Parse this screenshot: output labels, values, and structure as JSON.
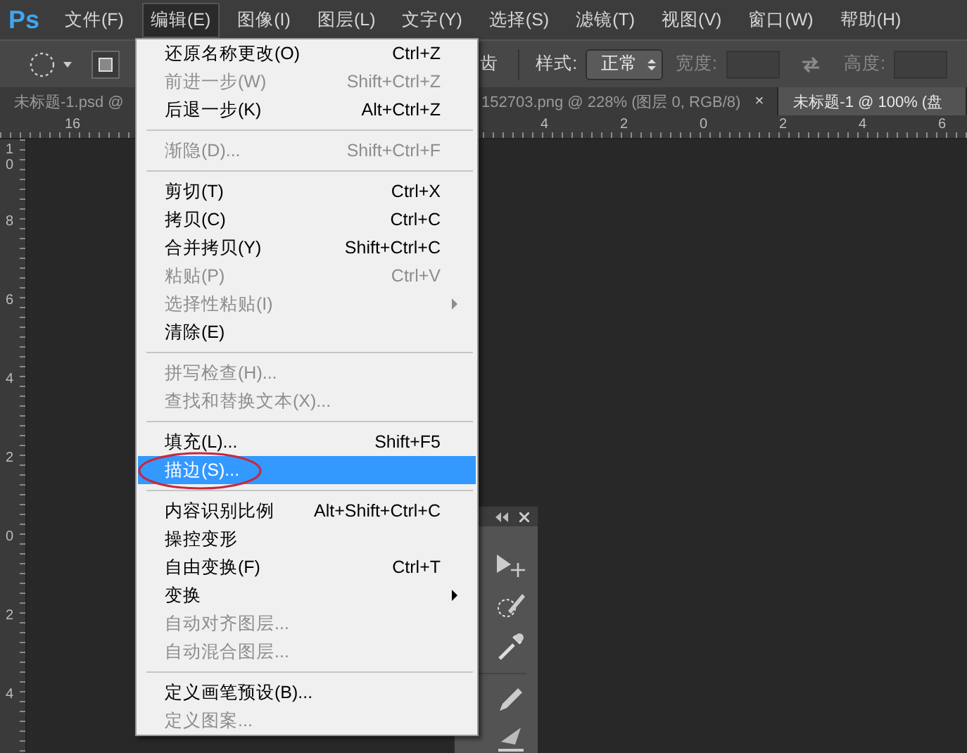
{
  "logo": "Ps",
  "menubar": [
    {
      "label": "文件(F)",
      "selected": false
    },
    {
      "label": "编辑(E)",
      "selected": true
    },
    {
      "label": "图像(I)",
      "selected": false
    },
    {
      "label": "图层(L)",
      "selected": false
    },
    {
      "label": "文字(Y)",
      "selected": false
    },
    {
      "label": "选择(S)",
      "selected": false
    },
    {
      "label": "滤镜(T)",
      "selected": false
    },
    {
      "label": "视图(V)",
      "selected": false
    },
    {
      "label": "窗口(W)",
      "selected": false
    },
    {
      "label": "帮助(H)",
      "selected": false
    }
  ],
  "options_bar": {
    "partial_label": "齿",
    "style": {
      "label": "样式:",
      "value": "正常"
    },
    "width": {
      "label": "宽度:",
      "disabled": true
    },
    "height": {
      "label": "高度:",
      "disabled": true
    }
  },
  "tabs": [
    {
      "title": "未标题-1.psd @",
      "selected": false
    },
    {
      "title": "152703.png @ 228% (图层 0, RGB/8)",
      "selected": false,
      "close": "×"
    },
    {
      "title": "未标题-1 @ 100% (盘",
      "selected": true
    }
  ],
  "rulers": {
    "horizontal": [
      "16",
      "4",
      "2",
      "0",
      "2",
      "4",
      "6"
    ],
    "vertical": [
      "10",
      "8",
      "6",
      "4",
      "2",
      "0",
      "2",
      "4"
    ]
  },
  "edit_menu": [
    {
      "kind": "item",
      "label": "还原名称更改(O)",
      "shortcut": "Ctrl+Z",
      "disabled": false,
      "selected": false,
      "submenu": false,
      "circled": false
    },
    {
      "kind": "item",
      "label": "前进一步(W)",
      "shortcut": "Shift+Ctrl+Z",
      "disabled": true,
      "selected": false,
      "submenu": false,
      "circled": false
    },
    {
      "kind": "item",
      "label": "后退一步(K)",
      "shortcut": "Alt+Ctrl+Z",
      "disabled": false,
      "selected": false,
      "submenu": false,
      "circled": false
    },
    {
      "kind": "separator"
    },
    {
      "kind": "item",
      "label": "渐隐(D)...",
      "shortcut": "Shift+Ctrl+F",
      "disabled": true,
      "selected": false,
      "submenu": false,
      "circled": false
    },
    {
      "kind": "separator"
    },
    {
      "kind": "item",
      "label": "剪切(T)",
      "shortcut": "Ctrl+X",
      "disabled": false,
      "selected": false,
      "submenu": false,
      "circled": false
    },
    {
      "kind": "item",
      "label": "拷贝(C)",
      "shortcut": "Ctrl+C",
      "disabled": false,
      "selected": false,
      "submenu": false,
      "circled": false
    },
    {
      "kind": "item",
      "label": "合并拷贝(Y)",
      "shortcut": "Shift+Ctrl+C",
      "disabled": false,
      "selected": false,
      "submenu": false,
      "circled": false
    },
    {
      "kind": "item",
      "label": "粘贴(P)",
      "shortcut": "Ctrl+V",
      "disabled": true,
      "selected": false,
      "submenu": false,
      "circled": false
    },
    {
      "kind": "item",
      "label": "选择性粘贴(I)",
      "disabled": true,
      "selected": false,
      "submenu": true,
      "circled": false
    },
    {
      "kind": "item",
      "label": "清除(E)",
      "disabled": false,
      "selected": false,
      "submenu": false,
      "circled": false
    },
    {
      "kind": "separator"
    },
    {
      "kind": "item",
      "label": "拼写检查(H)...",
      "disabled": true,
      "selected": false,
      "submenu": false,
      "circled": false
    },
    {
      "kind": "item",
      "label": "查找和替换文本(X)...",
      "disabled": true,
      "selected": false,
      "submenu": false,
      "circled": false
    },
    {
      "kind": "separator"
    },
    {
      "kind": "item",
      "label": "填充(L)...",
      "shortcut": "Shift+F5",
      "disabled": false,
      "selected": false,
      "submenu": false,
      "circled": false
    },
    {
      "kind": "item",
      "label": "描边(S)...",
      "disabled": false,
      "selected": true,
      "submenu": false,
      "circled": true
    },
    {
      "kind": "separator"
    },
    {
      "kind": "item",
      "label": "内容识别比例",
      "shortcut": "Alt+Shift+Ctrl+C",
      "disabled": false,
      "selected": false,
      "submenu": false,
      "circled": false
    },
    {
      "kind": "item",
      "label": "操控变形",
      "disabled": false,
      "selected": false,
      "submenu": false,
      "circled": false
    },
    {
      "kind": "item",
      "label": "自由变换(F)",
      "shortcut": "Ctrl+T",
      "disabled": false,
      "selected": false,
      "submenu": false,
      "circled": false
    },
    {
      "kind": "item",
      "label": "变换",
      "disabled": false,
      "selected": false,
      "submenu": true,
      "circled": false
    },
    {
      "kind": "item",
      "label": "自动对齐图层...",
      "disabled": true,
      "selected": false,
      "submenu": false,
      "circled": false
    },
    {
      "kind": "item",
      "label": "自动混合图层...",
      "disabled": true,
      "selected": false,
      "submenu": false,
      "circled": false
    },
    {
      "kind": "separator"
    },
    {
      "kind": "item",
      "label": "定义画笔预设(B)...",
      "disabled": false,
      "selected": false,
      "submenu": false,
      "circled": false
    },
    {
      "kind": "item",
      "label": "定义图案...",
      "disabled": true,
      "selected": false,
      "submenu": false,
      "circled": false
    }
  ]
}
